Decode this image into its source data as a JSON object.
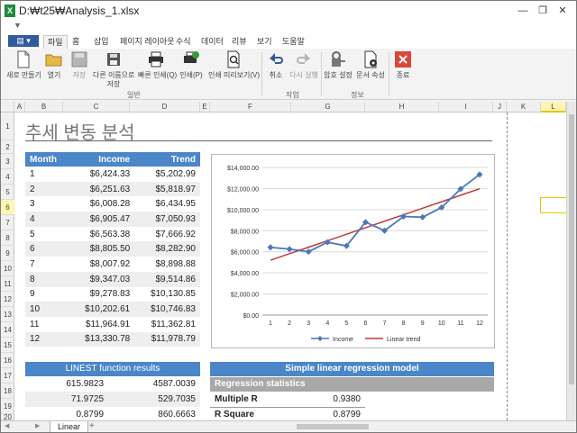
{
  "window": {
    "title": "D:₩t25₩Analysis_1.xlsx",
    "app_badge": "X",
    "minimize": "—",
    "restore": "❐",
    "close": "✕"
  },
  "quickbar": {
    "arrow": "▼"
  },
  "menu": {
    "file_label": "▤ ▾",
    "tabs": [
      "파일",
      "홈",
      "삽입",
      "페이지 레이아웃",
      "수식",
      "데이터",
      "리뷰",
      "보기",
      "도움말"
    ]
  },
  "ribbon": {
    "buttons": [
      {
        "label": "새로 만들기"
      },
      {
        "label": "열기"
      },
      {
        "label": "저장"
      },
      {
        "label": "다른 이름으로\n저장"
      },
      {
        "label": "빠른 인쇄(Q)"
      },
      {
        "label": "인쇄(P)"
      },
      {
        "label": "인쇄 미리보기(V)"
      },
      {
        "label": "취소"
      },
      {
        "label": "다시 실행"
      },
      {
        "label": "암호 설정"
      },
      {
        "label": "문서 속성"
      },
      {
        "label": "종료"
      }
    ],
    "groups": [
      "일반",
      "작업",
      "정보"
    ]
  },
  "columns": [
    "A",
    "B",
    "C",
    "D",
    "E",
    "F",
    "G",
    "H",
    "I",
    "J",
    "K",
    "L"
  ],
  "rows": [
    "1",
    "2",
    "3",
    "4",
    "5",
    "6",
    "7",
    "8",
    "9",
    "10",
    "11",
    "12",
    "13",
    "14",
    "15",
    "16",
    "17",
    "18",
    "19",
    "20"
  ],
  "sheet": {
    "title": "추세 변동 분석",
    "table_headers": [
      "Month",
      "Income",
      "Trend"
    ],
    "table_rows": [
      [
        "1",
        "$6,424.33",
        "$5,202.99"
      ],
      [
        "2",
        "$6,251.63",
        "$5,818.97"
      ],
      [
        "3",
        "$6,008.28",
        "$6,434.95"
      ],
      [
        "4",
        "$6,905.47",
        "$7,050.93"
      ],
      [
        "5",
        "$6,563.38",
        "$7,666.92"
      ],
      [
        "6",
        "$8,805.50",
        "$8,282.90"
      ],
      [
        "7",
        "$8,007.92",
        "$8,898.88"
      ],
      [
        "8",
        "$9,347.03",
        "$9,514.86"
      ],
      [
        "9",
        "$9,278.83",
        "$10,130.85"
      ],
      [
        "10",
        "$10,202.61",
        "$10,746.83"
      ],
      [
        "11",
        "$11,964.91",
        "$11,362.81"
      ],
      [
        "12",
        "$13,330.78",
        "$11,978.79"
      ]
    ],
    "linest_title": "LINEST function results",
    "linest_rows": [
      [
        "615.9823",
        "4587.0039"
      ],
      [
        "71.9725",
        "529.7035"
      ],
      [
        "0.8799",
        "860.6663"
      ]
    ],
    "regression_title": "Simple linear regression model",
    "regression_subtitle": "Regression statistics",
    "regression_rows": [
      [
        "Multiple R",
        "0.9380"
      ],
      [
        "R Square",
        "0.8799"
      ]
    ]
  },
  "tabs_bar": {
    "sheet_name": "Linear",
    "add": "+",
    "nav_prev": "◀",
    "nav_next": "▶"
  },
  "chart_data": {
    "type": "line",
    "x": [
      1,
      2,
      3,
      4,
      5,
      6,
      7,
      8,
      9,
      10,
      11,
      12
    ],
    "series": [
      {
        "name": "Income",
        "values": [
          6424.33,
          6251.63,
          6008.28,
          6905.47,
          6563.38,
          8805.5,
          8007.92,
          9347.03,
          9278.83,
          10202.61,
          11964.91,
          13330.78
        ],
        "color": "#4a78b8"
      },
      {
        "name": "Linear trend",
        "values": [
          5202.99,
          5818.97,
          6434.95,
          7050.93,
          7666.92,
          8282.9,
          8898.88,
          9514.86,
          10130.85,
          10746.83,
          11362.81,
          11978.79
        ],
        "color": "#c0393b"
      }
    ],
    "yticks": [
      "$0.00",
      "$2,000.00",
      "$4,000.00",
      "$6,000.00",
      "$8,000.00",
      "$10,000.00",
      "$12,000.00",
      "$14,000.00"
    ],
    "ylim": [
      0,
      14000
    ],
    "grid": true,
    "legend_placement": "bottom"
  }
}
